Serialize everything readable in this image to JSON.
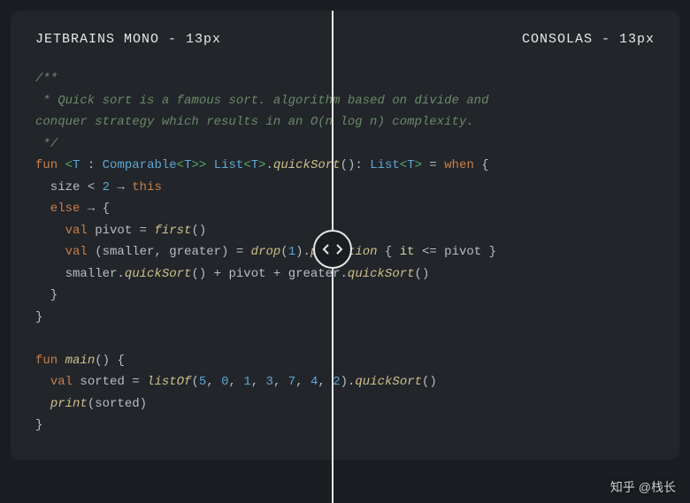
{
  "header": {
    "left_label": "JETBRAINS MONO - 13px",
    "right_label": "CONSOLAS - 13px"
  },
  "code": {
    "comment_open": "/**",
    "comment_line1": " * Quick sort is a famous sort. algorithm based on divide and",
    "comment_line2": "conquer strategy which results in an O(n log n) complexity.",
    "comment_close": " */",
    "kw_fun": "fun",
    "lt": "<",
    "gt": ">",
    "type_T": "T",
    "colon": " : ",
    "type_Comparable": "Comparable",
    "gt2": ">>",
    "space": " ",
    "type_List": "List",
    "dot": ".",
    "fn_quickSort": "quickSort",
    "parens": "()",
    "ret_sep": ": ",
    "eq": " = ",
    "kw_when": "when",
    "brace_open": " {",
    "size": "  size ",
    "ltop": "<",
    "two": " 2",
    "arrow": " → ",
    "kw_this": "this",
    "kw_else": "  else",
    "brace_open2": "{",
    "kw_val": "val",
    "pivot_eq": " pivot = ",
    "fn_first": "first",
    "destruct": " (smaller, greater) = ",
    "fn_drop": "drop",
    "fn_partition": "partition",
    "one": "1",
    "lparen": "(",
    "rparen": ")",
    "lbrace": " { ",
    "kw_it": "it",
    "lte": " <= ",
    "pivot_id": "pivot",
    "rbrace": " }",
    "smaller_id": "    smaller",
    "plus": " + ",
    "pivot_plus": "pivot + ",
    "greater_id": "greater",
    "close_brace": "  }",
    "close_brace2": "}",
    "main_id": "main",
    "sorted_eq": " sorted = ",
    "fn_listOf": "listOf",
    "n5": "5",
    "n0": "0",
    "n1": "1",
    "n3": "3",
    "n7": "7",
    "n4": "4",
    "n2": "2",
    "comma": ", ",
    "fn_print": "print",
    "sorted_id": "sorted",
    "indent2": "  ",
    "indent4": "    "
  },
  "watermark": "知乎 @栈长"
}
